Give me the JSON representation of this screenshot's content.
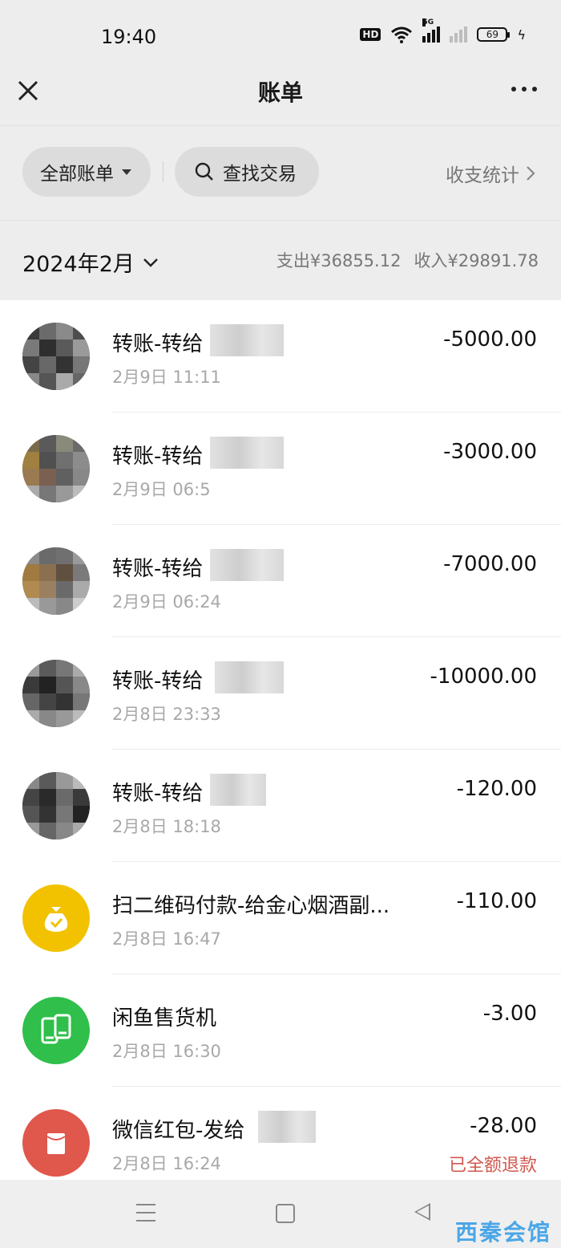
{
  "status": {
    "time": "19:40",
    "hd_label": "HD",
    "network_label": "5G",
    "battery": "69"
  },
  "header": {
    "title": "账单"
  },
  "filters": {
    "all_bills": "全部账单",
    "search": "查找交易",
    "stats": "收支统计"
  },
  "month": {
    "label": "2024年2月",
    "expense": "支出¥36855.12",
    "income": "收入¥29891.78"
  },
  "transactions": [
    {
      "title": "转账-转给",
      "date": "2月9日 11:11",
      "amount": "-5000.00"
    },
    {
      "title": "转账-转给",
      "date": "2月9日 06:5",
      "amount": "-3000.00"
    },
    {
      "title": "转账-转给",
      "date": "2月9日 06:24",
      "amount": "-7000.00"
    },
    {
      "title": "转账-转给",
      "date": "2月8日 23:33",
      "amount": "-10000.00"
    },
    {
      "title": "转账-转给",
      "date": "2月8日 18:18",
      "amount": "-120.00"
    },
    {
      "title": "扫二维码付款-给金心烟酒副...",
      "date": "2月8日 16:47",
      "amount": "-110.00",
      "icon": "money-bag-icon",
      "color": "#f2c200"
    },
    {
      "title": "闲鱼售货机",
      "date": "2月8日 16:30",
      "amount": "-3.00",
      "icon": "vending-machine-icon",
      "color": "#2fbf4a"
    },
    {
      "title": "微信红包-发给",
      "date": "2月8日 16:24",
      "amount": "-28.00",
      "note": "已全额退款",
      "icon": "red-envelope-icon",
      "color": "#e0574c"
    }
  ],
  "watermark": "西秦会馆",
  "colors": {
    "background": "#ededed",
    "refund": "#d0584f",
    "watermark": "#4aa6e8"
  }
}
